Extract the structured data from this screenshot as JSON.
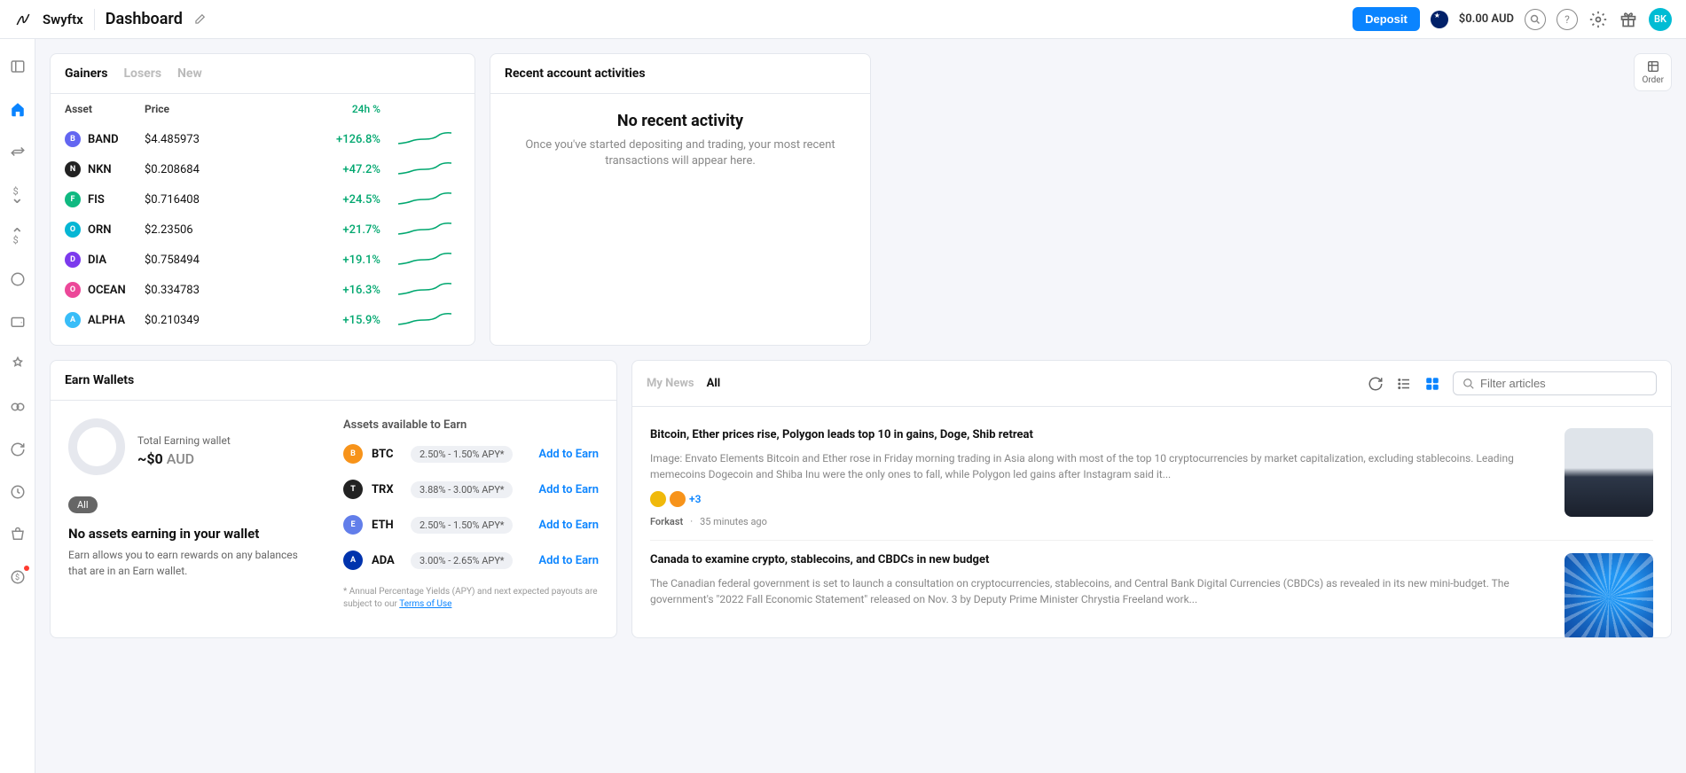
{
  "header": {
    "brand": "Swyftx",
    "page_title": "Dashboard",
    "deposit_label": "Deposit",
    "balance": "$0.00 AUD",
    "avatar": "BK",
    "order_label": "Order"
  },
  "gainers": {
    "tabs": [
      "Gainers",
      "Losers",
      "New"
    ],
    "active_tab": "Gainers",
    "columns": {
      "asset": "Asset",
      "price": "Price",
      "change": "24h %"
    },
    "rows": [
      {
        "symbol": "BAND",
        "price": "$4.485973",
        "change": "+126.8%",
        "color": "#6366f1"
      },
      {
        "symbol": "NKN",
        "price": "$0.208684",
        "change": "+47.2%",
        "color": "#222"
      },
      {
        "symbol": "FIS",
        "price": "$0.716408",
        "change": "+24.5%",
        "color": "#10b981"
      },
      {
        "symbol": "ORN",
        "price": "$2.23506",
        "change": "+21.7%",
        "color": "#06b6d4"
      },
      {
        "symbol": "DIA",
        "price": "$0.758494",
        "change": "+19.1%",
        "color": "#7c3aed"
      },
      {
        "symbol": "OCEAN",
        "price": "$0.334783",
        "change": "+16.3%",
        "color": "#ec4899"
      },
      {
        "symbol": "ALPHA",
        "price": "$0.210349",
        "change": "+15.9%",
        "color": "#38bdf8"
      }
    ]
  },
  "activities": {
    "header": "Recent account activities",
    "title": "No recent activity",
    "subtitle": "Once you've started depositing and trading, your most recent transactions will appear here."
  },
  "earn": {
    "header": "Earn Wallets",
    "total_label": "Total Earning wallet",
    "total_amount": "~$0",
    "total_currency": "AUD",
    "chip": "All",
    "subtitle": "No assets earning in your wallet",
    "description": "Earn allows you to earn rewards on any balances that are in an Earn wallet.",
    "assets_title": "Assets available to Earn",
    "add_label": "Add to Earn",
    "assets": [
      {
        "symbol": "BTC",
        "apy": "2.50% - 1.50% APY*",
        "color": "#f7931a"
      },
      {
        "symbol": "TRX",
        "apy": "3.88% - 3.00% APY*",
        "color": "#222"
      },
      {
        "symbol": "ETH",
        "apy": "2.50% - 1.50% APY*",
        "color": "#627eea"
      },
      {
        "symbol": "ADA",
        "apy": "3.00% - 2.65% APY*",
        "color": "#0033ad"
      }
    ],
    "footnote_pre": "* Annual Percentage Yields (APY) and next expected payouts are subject to our ",
    "footnote_link": "Terms of Use"
  },
  "news": {
    "tabs": [
      "My News",
      "All"
    ],
    "active_tab": "All",
    "filter_placeholder": "Filter articles",
    "articles": [
      {
        "title": "Bitcoin, Ether prices rise, Polygon leads top 10 in gains, Doge, Shib retreat",
        "snippet": "Image: Envato Elements Bitcoin and Ether rose in Friday morning trading in Asia along with most of the top 10 cryptocurrencies by market capitalization, excluding stablecoins. Leading memecoins Dogecoin and Shiba Inu were the only ones to fall, while Polygon led gains after Instagram said it...",
        "plus": "+3",
        "source": "Forkast",
        "time": "35 minutes ago",
        "thumb": 1
      },
      {
        "title": "Canada to examine crypto, stablecoins, and CBDCs in new budget",
        "snippet": "The Canadian federal government is set to launch a consultation on cryptocurrencies, stablecoins, and Central Bank Digital Currencies (CBDCs) as revealed in its new mini-budget. The government's \"2022 Fall Economic Statement\" released on Nov. 3 by Deputy Prime Minister Chrystia Freeland work...",
        "plus": "",
        "source": "",
        "time": "",
        "thumb": 2
      }
    ]
  }
}
